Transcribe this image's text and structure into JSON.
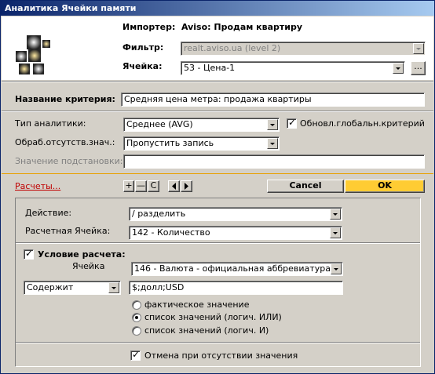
{
  "window": {
    "title": "Аналитика Ячейки памяти"
  },
  "header": {
    "importer_label": "Импортер:",
    "importer_value": "Aviso: Продам квартиру",
    "filter_label": "Фильтр:",
    "filter_value": "realt.aviso.ua (level 2)",
    "cell_label": "Ячейка:",
    "cell_value": "53 - Цена-1",
    "browse_label": "..."
  },
  "criterion": {
    "name_label": "Название критерия:",
    "name_value": "Средняя цена метра: продажа квартиры",
    "type_label": "Тип аналитики:",
    "type_value": "Среднее (AVG)",
    "update_global_label": "Обновл.глобальн.критерий",
    "update_global_checked": true,
    "missing_label": "Обраб.отсутств.знач.:",
    "missing_value": "Пропустить запись",
    "substitute_label": "Значение подстановки:",
    "substitute_value": ""
  },
  "toolbar": {
    "calc_link": "Расчеты...",
    "plus": "+",
    "minus": "—",
    "c": "C",
    "cancel_label": "Cancel",
    "ok_label": "OK"
  },
  "calc": {
    "action_label": "Действие:",
    "action_value": "/ разделить",
    "calc_cell_label": "Расчетная Ячейка:",
    "calc_cell_value": "142 - Количество",
    "condition_label": "Условие расчета:",
    "condition_checked": true,
    "cond_cell_label": "Ячейка",
    "cond_cell_value": "146 - Валюта - официальная аббревиатура",
    "operator_value": "Содержит",
    "cond_value": "$;долл;USD",
    "radio_actual": "фактическое значение",
    "radio_list_or": "список значений (логич. ИЛИ)",
    "radio_list_and": "список значений (логич. И)",
    "cancel_missing_label": "Отмена при отсутствии значения",
    "cancel_missing_checked": true
  },
  "colors": {
    "title_start": "#0a246a",
    "title_end": "#a6caf0",
    "ok_button": "#ffcc33",
    "link": "#c00000",
    "separator": "#e8a000"
  }
}
